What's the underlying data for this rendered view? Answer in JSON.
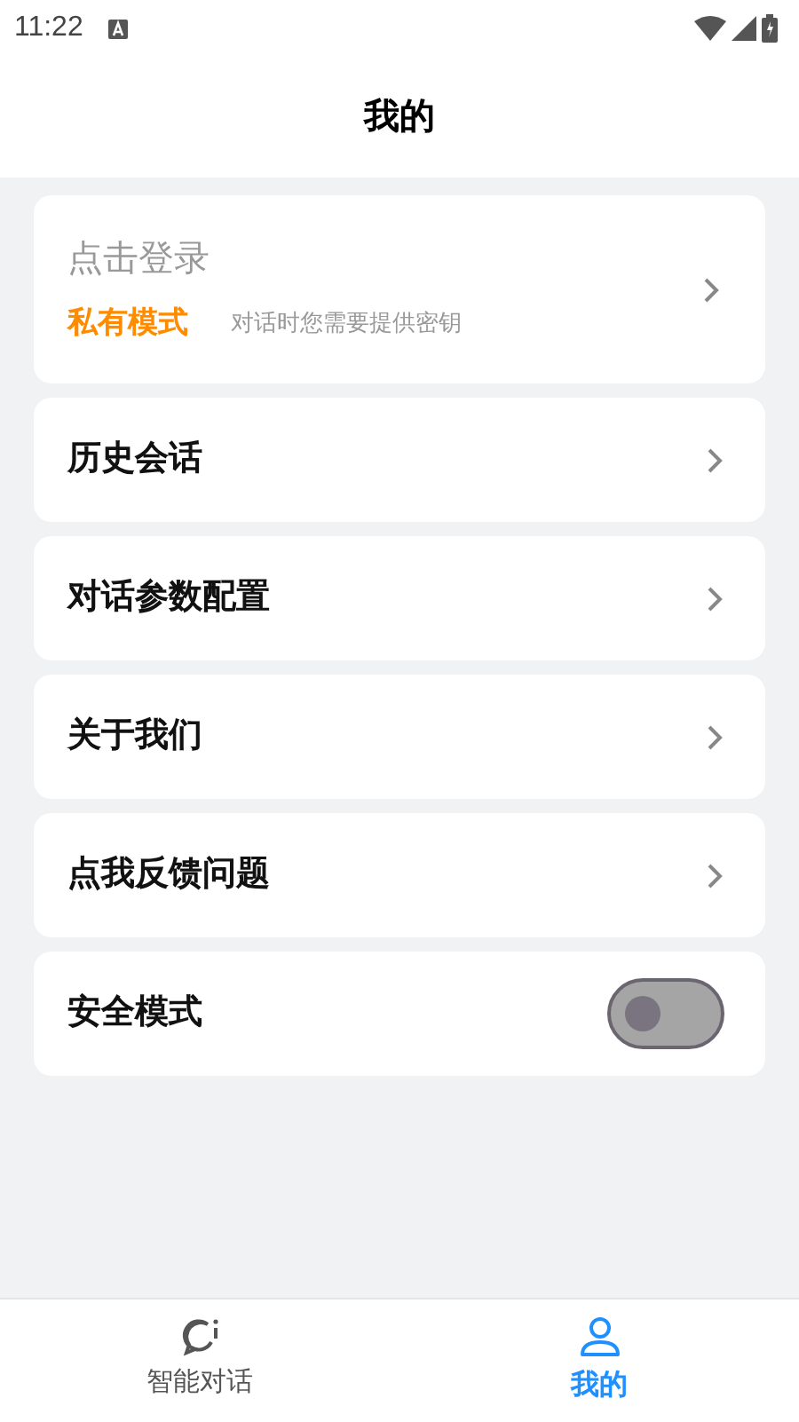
{
  "status_bar": {
    "time": "11:22"
  },
  "title": "我的",
  "login_card": {
    "title": "点击登录",
    "mode": "私有模式",
    "hint": "对话时您需要提供密钥"
  },
  "menu": [
    {
      "label": "历史会话",
      "kind": "link"
    },
    {
      "label": "对话参数配置",
      "kind": "link"
    },
    {
      "label": "关于我们",
      "kind": "link"
    },
    {
      "label": "点我反馈问题",
      "kind": "link"
    },
    {
      "label": "安全模式",
      "kind": "toggle",
      "on": false
    }
  ],
  "tabs": [
    {
      "label": "智能对话",
      "kind": "chat",
      "selected": false
    },
    {
      "label": "我的",
      "kind": "profile",
      "selected": true
    }
  ]
}
